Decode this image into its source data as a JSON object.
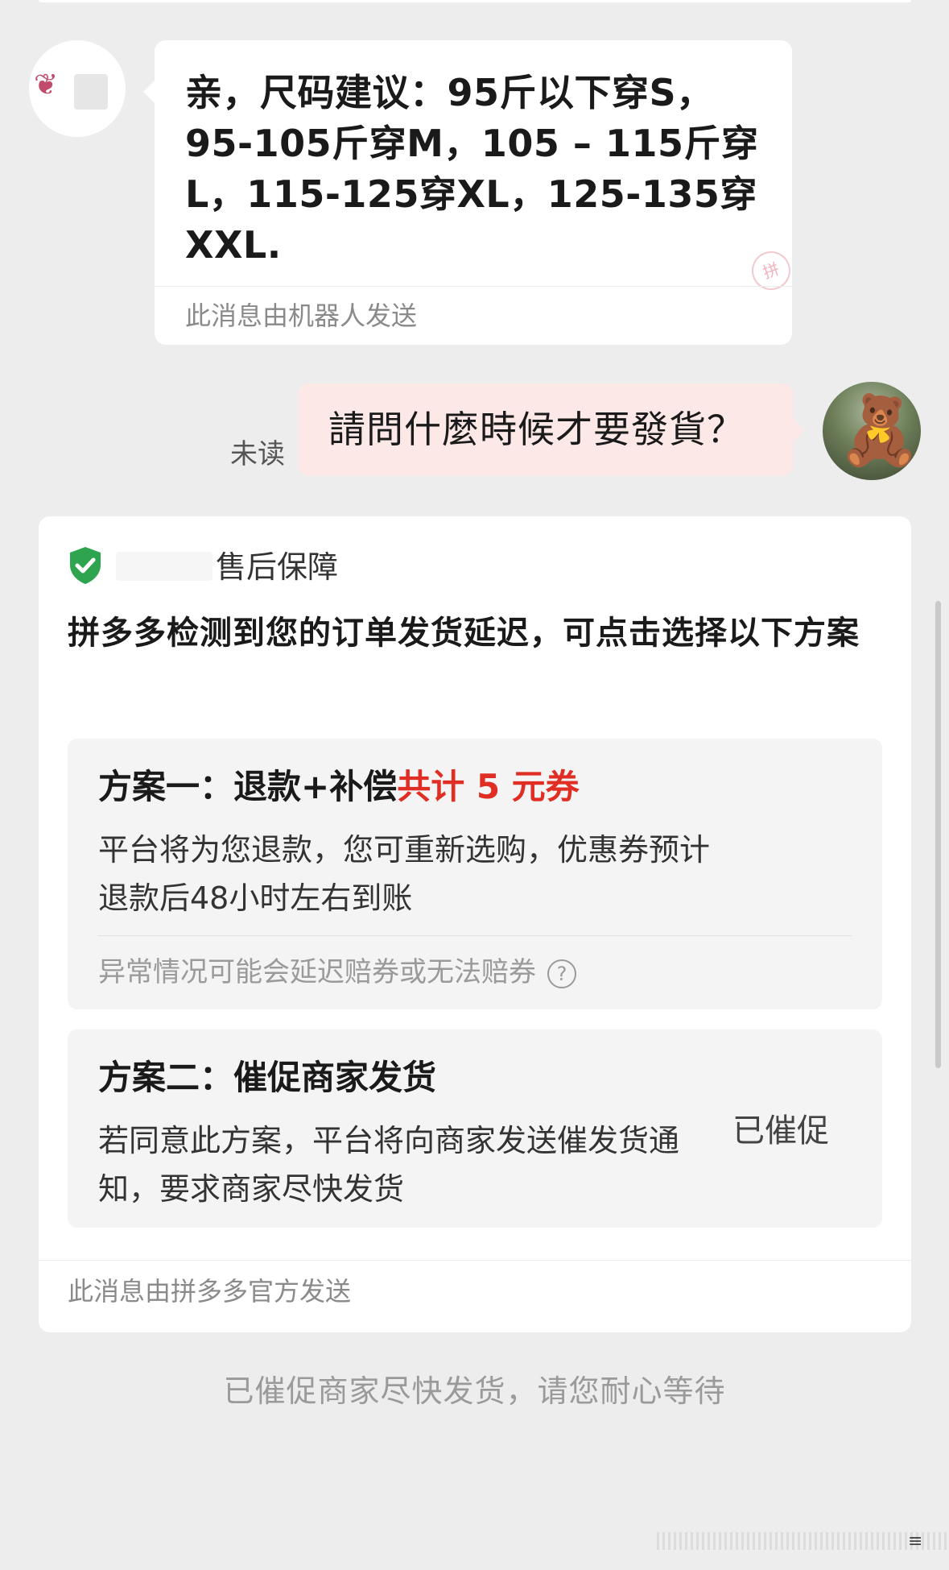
{
  "seller_message": {
    "text": "亲，尺码建议：95斤以下穿S，95-105斤穿M，105 – 115斤穿L，115-125穿XL，125-135穿XXL.",
    "footer": "此消息由机器人发送",
    "stamp": "拼"
  },
  "user_message": {
    "status": "未读",
    "text": "請問什麼時候才要發貨？"
  },
  "official_card": {
    "guarantee_label": "售后保障",
    "description": "拼多多检测到您的订单发货延迟，可点击选择以下方案",
    "plan1": {
      "title_main": "方案一：退款+补偿",
      "title_highlight": "共计 5 元券",
      "body": "平台将为您退款，您可重新选购，优惠券预计退款后48小时左右到账",
      "note": "异常情况可能会延迟赔券或无法赔券",
      "help_icon": "?"
    },
    "plan2": {
      "title": "方案二：催促商家发货",
      "body": "若同意此方案，平台将向商家发送催发货通知，要求商家尽快发货",
      "status": "已催促"
    },
    "footer": "此消息由拼多多官方发送"
  },
  "system_notice": "已催促商家尽快发货，请您耐心等待",
  "colors": {
    "background": "#ededed",
    "highlight_red": "#e02e24",
    "shield_green": "#2ea44f",
    "user_bubble": "#fce8e7"
  },
  "icons": {
    "shield": "shield-check-icon",
    "help": "question-circle-icon"
  }
}
